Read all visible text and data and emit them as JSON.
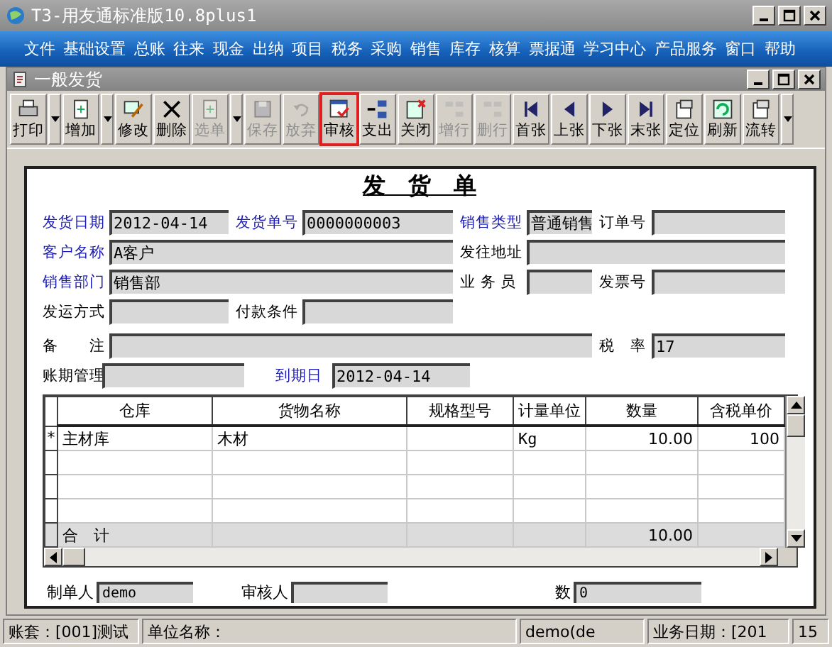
{
  "window": {
    "title": "T3-用友通标准版10.8plus1"
  },
  "menu": [
    "文件",
    "基础设置",
    "总账",
    "往来",
    "现金",
    "出纳",
    "项目",
    "税务",
    "采购",
    "销售",
    "库存",
    "核算",
    "票据通",
    "学习中心",
    "产品服务",
    "窗口",
    "帮助"
  ],
  "child_window": {
    "title": "一般发货"
  },
  "toolbar": [
    {
      "label": "打印",
      "kind": "print",
      "disabled": false,
      "dropdown": true,
      "highlighted": false
    },
    {
      "label": "增加",
      "kind": "add",
      "disabled": false,
      "dropdown": true,
      "highlighted": false
    },
    {
      "label": "修改",
      "kind": "edit",
      "disabled": false,
      "dropdown": false,
      "highlighted": false
    },
    {
      "label": "删除",
      "kind": "delete",
      "disabled": false,
      "dropdown": false,
      "highlighted": false
    },
    {
      "label": "选单",
      "kind": "add",
      "disabled": true,
      "dropdown": true,
      "highlighted": false
    },
    {
      "label": "保存",
      "kind": "save",
      "disabled": true,
      "dropdown": false,
      "highlighted": false
    },
    {
      "label": "放弃",
      "kind": "undo",
      "disabled": true,
      "dropdown": false,
      "highlighted": false
    },
    {
      "label": "审核",
      "kind": "audit",
      "disabled": false,
      "dropdown": false,
      "highlighted": true
    },
    {
      "label": "支出",
      "kind": "split",
      "disabled": false,
      "dropdown": false,
      "highlighted": false
    },
    {
      "label": "关闭",
      "kind": "close",
      "disabled": false,
      "dropdown": false,
      "highlighted": false
    },
    {
      "label": "增行",
      "kind": "rows",
      "disabled": true,
      "dropdown": false,
      "highlighted": false
    },
    {
      "label": "删行",
      "kind": "rows",
      "disabled": true,
      "dropdown": false,
      "highlighted": false
    },
    {
      "label": "首张",
      "kind": "first",
      "disabled": false,
      "dropdown": false,
      "highlighted": false
    },
    {
      "label": "上张",
      "kind": "prev",
      "disabled": false,
      "dropdown": false,
      "highlighted": false
    },
    {
      "label": "下张",
      "kind": "next",
      "disabled": false,
      "dropdown": false,
      "highlighted": false
    },
    {
      "label": "末张",
      "kind": "last",
      "disabled": false,
      "dropdown": false,
      "highlighted": false
    },
    {
      "label": "定位",
      "kind": "locate",
      "disabled": false,
      "dropdown": false,
      "highlighted": false
    },
    {
      "label": "刷新",
      "kind": "refresh",
      "disabled": false,
      "dropdown": false,
      "highlighted": false
    },
    {
      "label": "流转",
      "kind": "locate",
      "disabled": false,
      "dropdown": true,
      "highlighted": false
    }
  ],
  "form": {
    "title": "发　货　单",
    "fields": [
      {
        "label": "发货日期",
        "required": true,
        "value": "2012-04-14"
      },
      {
        "label": "发货单号",
        "required": true,
        "value": "0000000003"
      },
      {
        "label": "销售类型",
        "required": true,
        "value": "普通销售"
      },
      {
        "label": "订单号",
        "required": false
      },
      {
        "label": "客户名称",
        "required": true,
        "value": "A客户"
      },
      {
        "label": "发往地址",
        "required": false
      },
      {
        "label": "销售部门",
        "required": true,
        "value": "销售部"
      },
      {
        "label": "业 务 员",
        "required": false
      },
      {
        "label": "发票号",
        "required": false
      },
      {
        "label": "发运方式",
        "required": false
      },
      {
        "label": "付款条件",
        "required": false
      },
      {
        "label": "备　　注",
        "required": false
      },
      {
        "label": "税　率",
        "required": false,
        "value": "17"
      },
      {
        "label": "账期管理",
        "required": false
      },
      {
        "label": "到期日",
        "required": true,
        "value": "2012-04-14"
      }
    ]
  },
  "table": {
    "columns": [
      "仓库",
      "货物名称",
      "规格型号",
      "计量单位",
      "数量",
      "含税单价"
    ],
    "rows": [
      {
        "marker": "*",
        "cells": [
          "主材库",
          "木材",
          "",
          "Kg",
          "10.00",
          "100"
        ]
      },
      {
        "cells": [
          "",
          "",
          "",
          "",
          "",
          ""
        ]
      },
      {
        "cells": [
          "",
          "",
          "",
          "",
          "",
          ""
        ]
      },
      {
        "cells": [
          "",
          "",
          "",
          "",
          "",
          ""
        ]
      }
    ],
    "total": {
      "label": "合　计",
      "quantity": "10.00"
    }
  },
  "footer": [
    {
      "label": "制单人",
      "value": "demo"
    },
    {
      "label": "审核人"
    },
    {
      "label": "数",
      "value": "0"
    }
  ],
  "status_bar": [
    "账套：[001]测试",
    "单位名称：",
    "demo(de",
    "业务日期：[201",
    "15"
  ]
}
